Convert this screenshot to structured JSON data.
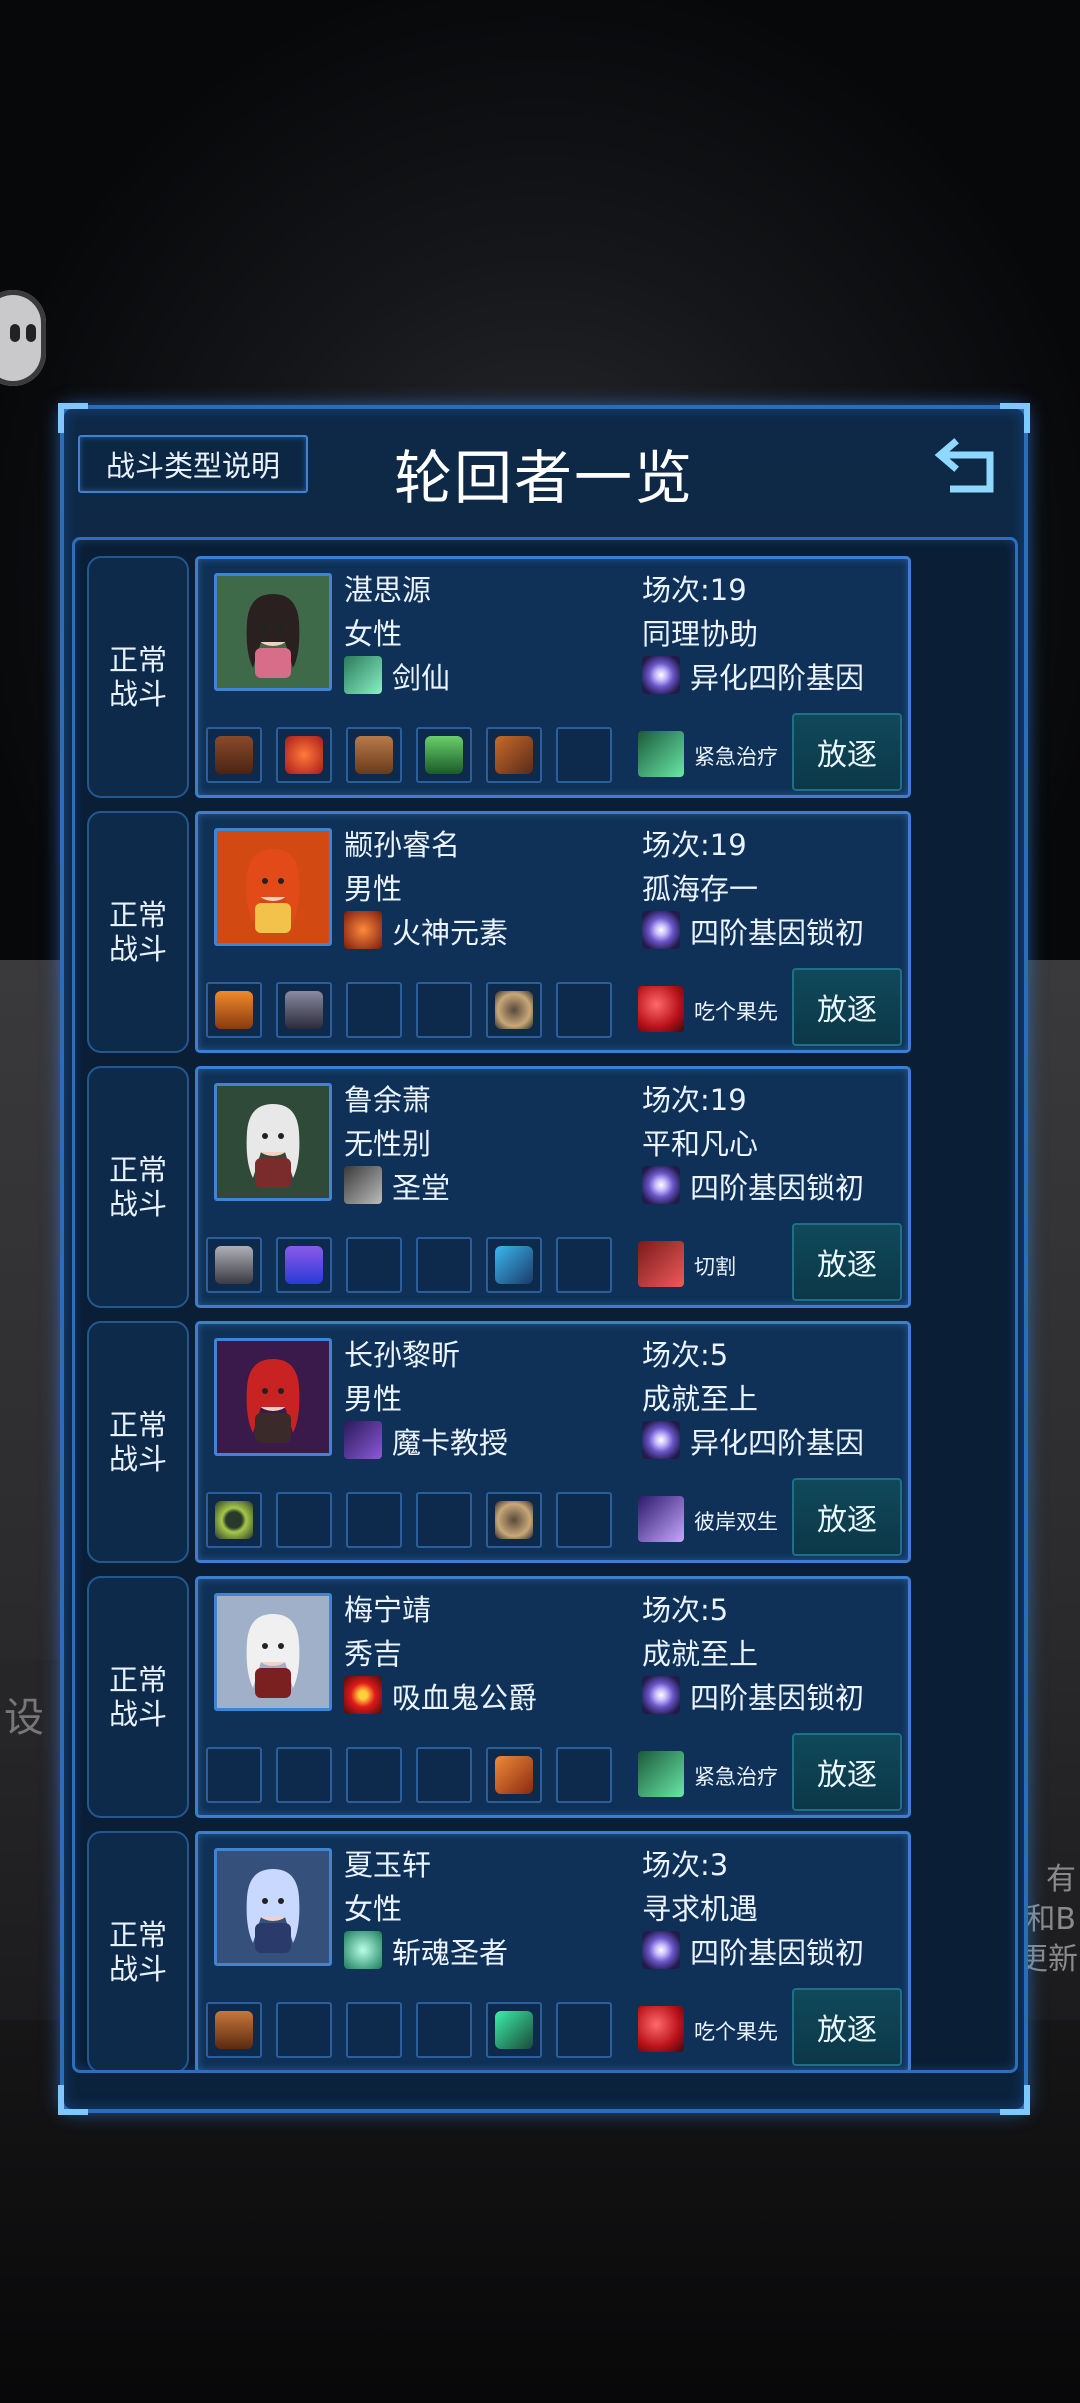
{
  "panel": {
    "title": "轮回者一览",
    "help_button": "战斗类型说明"
  },
  "background": {
    "left_text": "设",
    "right_text": "有\n和B\n更新"
  },
  "colors": {
    "panel_bg": "#0e2947",
    "border": "#2c6db7",
    "exile_button": "#10495a"
  },
  "reincarnators": [
    {
      "battle_type": "正常\n战斗",
      "name": "湛思源",
      "gender": "女性",
      "battles": "场次:19",
      "trait": "同理协助",
      "class": "剑仙",
      "class_icon": "crossed-swords-icon",
      "gene": "异化四阶基因",
      "items": [
        "boots",
        "red-orb",
        "brown-armor",
        "green-bracers",
        "axe",
        "empty"
      ],
      "skill": "紧急治疗",
      "skill_icon": "heal-cross-icon",
      "action": "放逐"
    },
    {
      "battle_type": "正常\n战斗",
      "name": "颛孙睿名",
      "gender": "男性",
      "battles": "场次:19",
      "trait": "孤海存一",
      "class": "火神元素",
      "class_icon": "fire-element-icon",
      "gene": "四阶基因锁初",
      "items": [
        "orange-book",
        "dark-armor",
        "empty",
        "empty",
        "bow",
        "empty"
      ],
      "skill": "吃个果先",
      "skill_icon": "red-fruit-icon",
      "action": "放逐"
    },
    {
      "battle_type": "正常\n战斗",
      "name": "鲁余萧",
      "gender": "无性别",
      "battles": "场次:19",
      "trait": "平和凡心",
      "class": "圣堂",
      "class_icon": "crossbow-icon",
      "gene": "四阶基因锁初",
      "items": [
        "gray-gauntlet",
        "purple-potion",
        "empty",
        "empty",
        "blue-bow",
        "empty"
      ],
      "skill": "切割",
      "skill_icon": "cut-icon",
      "action": "放逐"
    },
    {
      "battle_type": "正常\n战斗",
      "name": "长孙黎昕",
      "gender": "男性",
      "battles": "场次:5",
      "trait": "成就至上",
      "class": "魔卡教授",
      "class_icon": "magic-card-icon",
      "gene": "异化四阶基因",
      "items": [
        "necklace",
        "empty",
        "empty",
        "empty",
        "bow",
        "empty"
      ],
      "skill": "彼岸双生",
      "skill_icon": "twin-spirit-icon",
      "action": "放逐"
    },
    {
      "battle_type": "正常\n战斗",
      "name": "梅宁靖",
      "gender": "秀吉",
      "battles": "场次:5",
      "trait": "成就至上",
      "class": "吸血鬼公爵",
      "class_icon": "vampire-eye-icon",
      "gene": "四阶基因锁初",
      "items": [
        "empty",
        "empty",
        "empty",
        "empty",
        "red-bow",
        "empty"
      ],
      "skill": "紧急治疗",
      "skill_icon": "heal-cross-icon",
      "action": "放逐"
    },
    {
      "battle_type": "正常\n战斗",
      "name": "夏玉轩",
      "gender": "女性",
      "battles": "场次:3",
      "trait": "寻求机遇",
      "class": "斩魂圣者",
      "class_icon": "ghost-icon",
      "gene": "四阶基因锁初",
      "items": [
        "brown-glove",
        "empty",
        "empty",
        "empty",
        "green-claw",
        "empty"
      ],
      "skill": "吃个果先",
      "skill_icon": "red-fruit-icon",
      "action": "放逐"
    }
  ]
}
